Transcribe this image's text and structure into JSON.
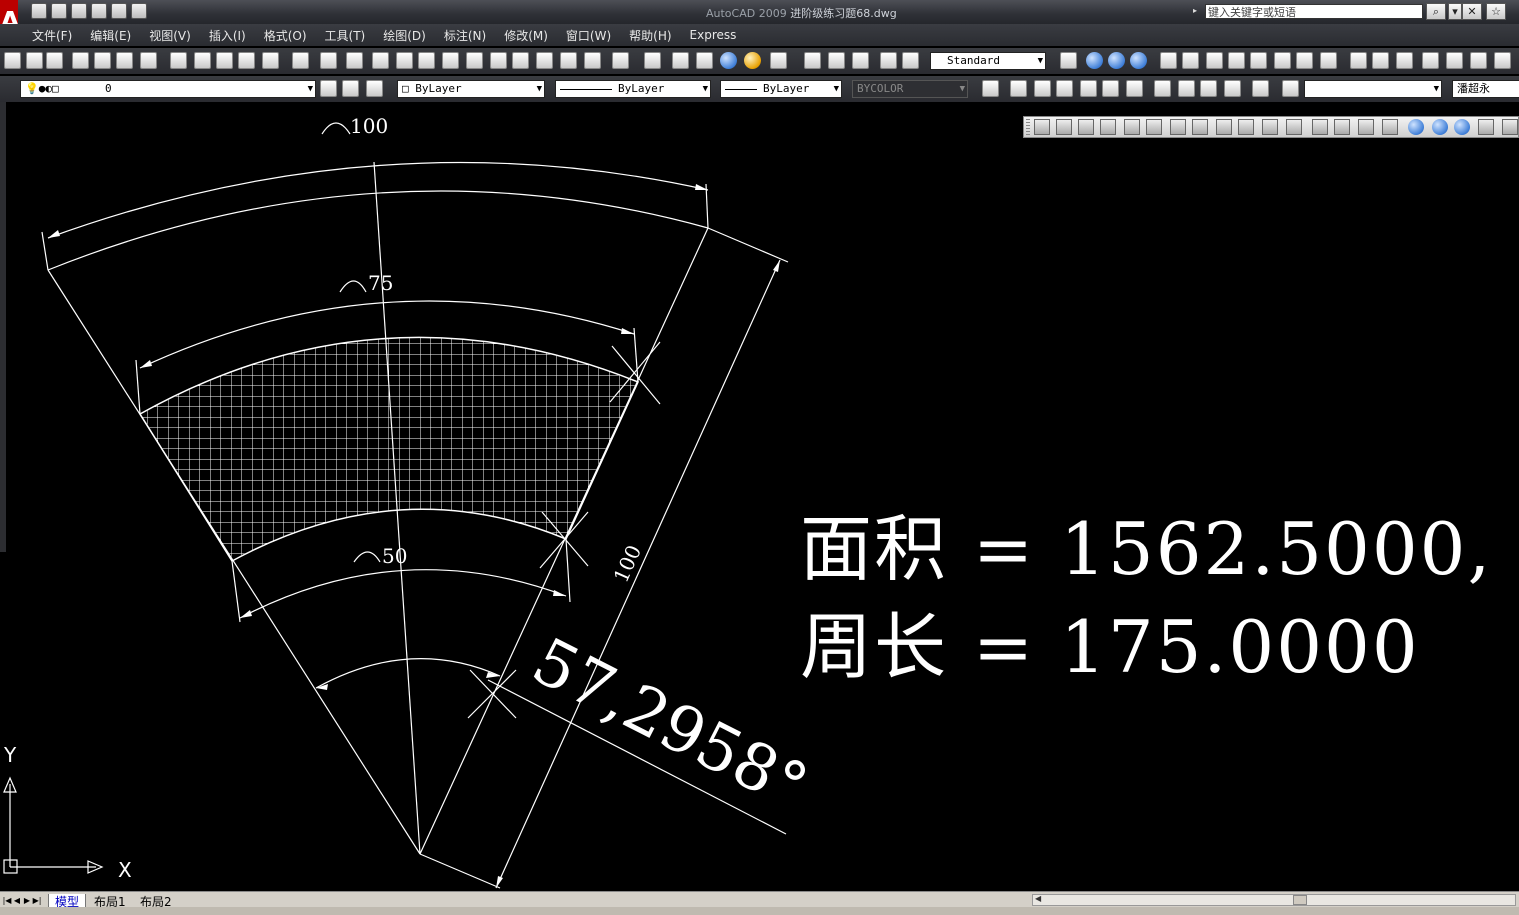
{
  "app": {
    "name": "AutoCAD 2009",
    "file": "进阶级练习题68.dwg",
    "search_placeholder": "键入关键字或短语",
    "logo": "A"
  },
  "menu": [
    "文件(F)",
    "编辑(E)",
    "视图(V)",
    "插入(I)",
    "格式(O)",
    "工具(T)",
    "绘图(D)",
    "标注(N)",
    "修改(M)",
    "窗口(W)",
    "帮助(H)",
    "Express"
  ],
  "toolbar": {
    "text_style": "Standard",
    "layer": "0",
    "color": "ByLayer",
    "linetype": "ByLayer",
    "lineweight": "ByLayer",
    "plotstyle": "BYCOLOR",
    "user": "潘超永"
  },
  "drawing": {
    "arc_labels": [
      "100",
      "75",
      "50"
    ],
    "radius_label": "100",
    "angle_label": "57,2958°",
    "axis_x": "X",
    "axis_y": "Y"
  },
  "measure": {
    "area_line": "面积 = 1562.5000,",
    "perimeter_line": "周长 = 175.0000"
  },
  "tabs": [
    "模型",
    "布局1",
    "布局2"
  ],
  "colors": {
    "background": "#000000",
    "line": "#ffffff",
    "active_tab": "#0000c0"
  }
}
